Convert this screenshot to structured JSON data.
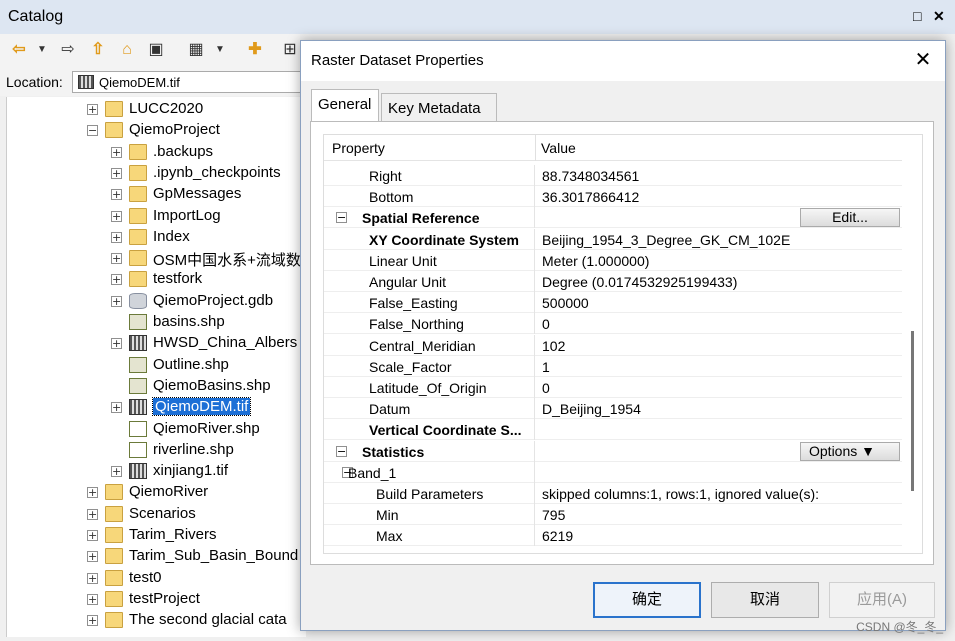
{
  "catalog": {
    "title": "Catalog",
    "location_label": "Location:",
    "location_value": "QiemoDEM.tif",
    "tree": [
      {
        "label": "LUCC2020",
        "icon": "folder-icon",
        "expand": "+",
        "sel": false
      },
      {
        "label": "QiemoProject",
        "icon": "folder-icon",
        "expand": "−",
        "sel": false
      },
      {
        "label": ".backups",
        "icon": "folder-icon",
        "expand": "+",
        "sel": false
      },
      {
        "label": ".ipynb_checkpoints",
        "icon": "folder-icon",
        "expand": "+",
        "sel": false
      },
      {
        "label": "GpMessages",
        "icon": "folder-icon",
        "expand": "+",
        "sel": false
      },
      {
        "label": "ImportLog",
        "icon": "folder-icon",
        "expand": "+",
        "sel": false
      },
      {
        "label": "Index",
        "icon": "folder-icon",
        "expand": "+",
        "sel": false
      },
      {
        "label": "OSM中国水系+流域数",
        "icon": "folder-icon",
        "expand": "+",
        "sel": false
      },
      {
        "label": "testfork",
        "icon": "folder-icon",
        "expand": "+",
        "sel": false
      },
      {
        "label": "QiemoProject.gdb",
        "icon": "geodatabase-icon",
        "expand": "+",
        "sel": false
      },
      {
        "label": "basins.shp",
        "icon": "polygon-shapefile-icon",
        "expand": "",
        "sel": false
      },
      {
        "label": "HWSD_China_Albers",
        "icon": "raster-icon",
        "expand": "+",
        "sel": false
      },
      {
        "label": "Outline.shp",
        "icon": "polygon-shapefile-icon",
        "expand": "",
        "sel": false
      },
      {
        "label": "QiemoBasins.shp",
        "icon": "polygon-shapefile-icon",
        "expand": "",
        "sel": false
      },
      {
        "label": "QiemoDEM.tif",
        "icon": "raster-icon",
        "expand": "+",
        "sel": true
      },
      {
        "label": "QiemoRiver.shp",
        "icon": "line-shapefile-icon",
        "expand": "",
        "sel": false
      },
      {
        "label": "riverline.shp",
        "icon": "line-shapefile-icon",
        "expand": "",
        "sel": false
      },
      {
        "label": "xinjiang1.tif",
        "icon": "raster-icon",
        "expand": "+",
        "sel": false
      },
      {
        "label": "QiemoRiver",
        "icon": "folder-icon",
        "expand": "+",
        "sel": false
      },
      {
        "label": "Scenarios",
        "icon": "folder-icon",
        "expand": "+",
        "sel": false
      },
      {
        "label": "Tarim_Rivers",
        "icon": "folder-icon",
        "expand": "+",
        "sel": false
      },
      {
        "label": "Tarim_Sub_Basin_Bound",
        "icon": "folder-icon",
        "expand": "+",
        "sel": false
      },
      {
        "label": "test0",
        "icon": "folder-icon",
        "expand": "+",
        "sel": false
      },
      {
        "label": "testProject",
        "icon": "folder-icon",
        "expand": "+",
        "sel": false
      },
      {
        "label": "The second glacial cata",
        "icon": "folder-icon",
        "expand": "+",
        "sel": false
      }
    ]
  },
  "dialog": {
    "title": "Raster Dataset Properties",
    "tabs": [
      "General",
      "Key Metadata"
    ],
    "header": {
      "property": "Property",
      "value": "Value"
    },
    "rows": [
      {
        "name": "Right",
        "value": "88.7348034561",
        "level": 2,
        "bold": false,
        "expand": "",
        "button": ""
      },
      {
        "name": "Bottom",
        "value": "36.3017866412",
        "level": 2,
        "bold": false,
        "expand": "",
        "button": ""
      },
      {
        "name": "Spatial Reference",
        "value": "",
        "level": 1,
        "bold": true,
        "expand": "−",
        "button": "Edit..."
      },
      {
        "name": "XY Coordinate System",
        "value": "Beijing_1954_3_Degree_GK_CM_102E",
        "level": 2,
        "bold": true,
        "expand": "",
        "button": ""
      },
      {
        "name": "Linear Unit",
        "value": "Meter (1.000000)",
        "level": 2,
        "bold": false,
        "expand": "",
        "button": ""
      },
      {
        "name": "Angular Unit",
        "value": "Degree (0.0174532925199433)",
        "level": 2,
        "bold": false,
        "expand": "",
        "button": ""
      },
      {
        "name": "False_Easting",
        "value": "500000",
        "level": 2,
        "bold": false,
        "expand": "",
        "button": ""
      },
      {
        "name": "False_Northing",
        "value": "0",
        "level": 2,
        "bold": false,
        "expand": "",
        "button": ""
      },
      {
        "name": "Central_Meridian",
        "value": "102",
        "level": 2,
        "bold": false,
        "expand": "",
        "button": ""
      },
      {
        "name": "Scale_Factor",
        "value": "1",
        "level": 2,
        "bold": false,
        "expand": "",
        "button": ""
      },
      {
        "name": "Latitude_Of_Origin",
        "value": "0",
        "level": 2,
        "bold": false,
        "expand": "",
        "button": ""
      },
      {
        "name": "Datum",
        "value": "D_Beijing_1954",
        "level": 2,
        "bold": false,
        "expand": "",
        "button": ""
      },
      {
        "name": "Vertical Coordinate S...",
        "value": "",
        "level": 2,
        "bold": true,
        "expand": "",
        "button": ""
      },
      {
        "name": "Statistics",
        "value": "",
        "level": 1,
        "bold": true,
        "expand": "−",
        "button": "Options ▼"
      },
      {
        "name": "Band_1",
        "value": "",
        "level": 1.5,
        "bold": false,
        "expand": "−",
        "button": ""
      },
      {
        "name": "Build Parameters",
        "value": "skipped columns:1, rows:1, ignored value(s):",
        "level": 3,
        "bold": false,
        "expand": "",
        "button": ""
      },
      {
        "name": "Min",
        "value": "795",
        "level": 3,
        "bold": false,
        "expand": "",
        "button": ""
      },
      {
        "name": "Max",
        "value": "6219",
        "level": 3,
        "bold": false,
        "expand": "",
        "button": ""
      }
    ],
    "buttons": {
      "ok": "确定",
      "cancel": "取消",
      "apply": "应用(A)"
    }
  },
  "watermark": "CSDN @冬_冬_"
}
